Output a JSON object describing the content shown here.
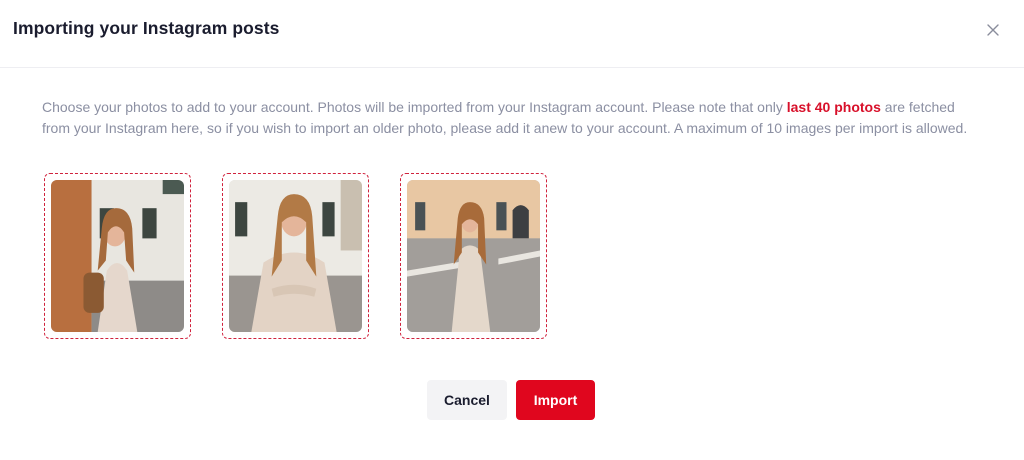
{
  "dialog": {
    "title": "Importing your Instagram posts",
    "close_icon": "close-icon",
    "description_before": "Choose your photos to add to your account. Photos will be imported from your Instagram account. Please note that only ",
    "description_highlight": "last 40 photos",
    "description_after": " are fetched from your Instagram here, so if you wish to import an older photo, please add it anew to your account. A maximum of 10 images per import is allowed.",
    "highlight_color": "#d8102a"
  },
  "photos": [
    {
      "id": 1,
      "selected": true
    },
    {
      "id": 2,
      "selected": true
    },
    {
      "id": 3,
      "selected": true
    }
  ],
  "actions": {
    "cancel_label": "Cancel",
    "import_label": "Import",
    "import_color": "#e0061e"
  }
}
